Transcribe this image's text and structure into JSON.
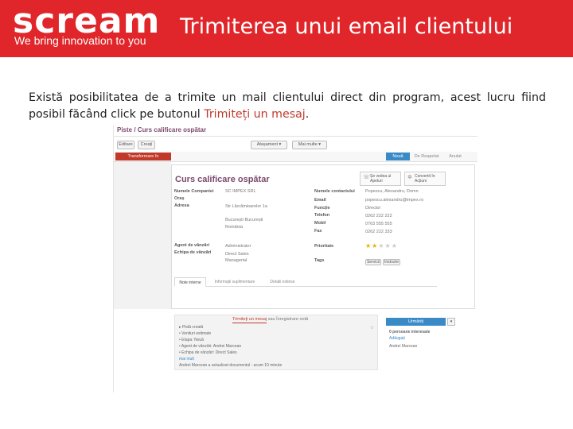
{
  "banner": {
    "logo": "scream",
    "tagline": "We bring innovation to you",
    "title": "Trimiterea unui email clientului",
    "color": "#e0262a"
  },
  "paragraph": {
    "before": "Există posibilitatea de a trimite un mail clientului direct din program, acest lucru fiind posibil făcând click pe butonul ",
    "link": "Trimiteți un mesaj",
    "after": "."
  },
  "screenshot": {
    "breadcrumb": "Piste / Curs calificare ospătar",
    "buttons": [
      "Editare",
      "Creaţi"
    ],
    "actions": [
      "Atașament ▾",
      "Mai multe ▾"
    ],
    "primary_action": "Transformare în Oportunitate",
    "stages": [
      "Nouă",
      "De Reapelat",
      "Anulat"
    ],
    "form_title": "Curs calificare ospătar",
    "smart_buttons": [
      {
        "icon": "phone-icon",
        "text": "Șe vedea ul Apeluri"
      },
      {
        "icon": "gear-icon",
        "text": "Convertit în Acțiuni"
      }
    ],
    "left_fields": [
      {
        "label": "Numele Companiei",
        "value": "SC IMPEX SRL"
      },
      {
        "label": "Oraș",
        "value": ""
      },
      {
        "label": "Adresa",
        "value": "Str Lăcrămioarelor 1a"
      },
      {
        "label": "",
        "value": "București    București"
      },
      {
        "label": "",
        "value": "România"
      },
      {
        "label": "Agent de vânzări",
        "value": "Administrator"
      },
      {
        "label": "Echipa de vânzări",
        "value": "Direct Sales"
      },
      {
        "label": "",
        "value": "Managerial"
      }
    ],
    "right_fields": [
      {
        "label": "Numele contactului",
        "value": "Popescu, Alexandru, Domn"
      },
      {
        "label": "Email",
        "value": "popescu.alexandru@impex.ro"
      },
      {
        "label": "Funcție",
        "value": "Director"
      },
      {
        "label": "Telefon",
        "value": "0262 222 222"
      },
      {
        "label": "Mobil",
        "value": "0763 555 555"
      },
      {
        "label": "Fax",
        "value": "0262 222 333"
      },
      {
        "label": "Prioritate",
        "value": ""
      },
      {
        "label": "Tags",
        "value": ""
      }
    ],
    "tags": [
      "Servicii",
      "Instruire"
    ],
    "priority_stars": 2,
    "priority_max": 5,
    "tabs": [
      "Note interne",
      "Informații suplimentare",
      "Detalii extinse"
    ],
    "chatter_tabs": {
      "send": "Trimiteţi un mesaj",
      "separator": "sau",
      "log": "Înregistrare notă"
    },
    "chatter_lines": [
      "▸ Pistă creată",
      "  • Venituri estimate",
      "  • Etapa: Nouă",
      "  • Agent de vânzări: Andrei Marcean",
      "  • Echipa de vânzări: Direct Sales",
      "mai mult",
      "Andrei Marcean a actualizat documentul - acum 10 minute"
    ],
    "follow_label": "Urmăriți",
    "followers_title": "0 persoane interesate",
    "followers_action": "Adăugați",
    "follower": "Andrei Marcean"
  }
}
